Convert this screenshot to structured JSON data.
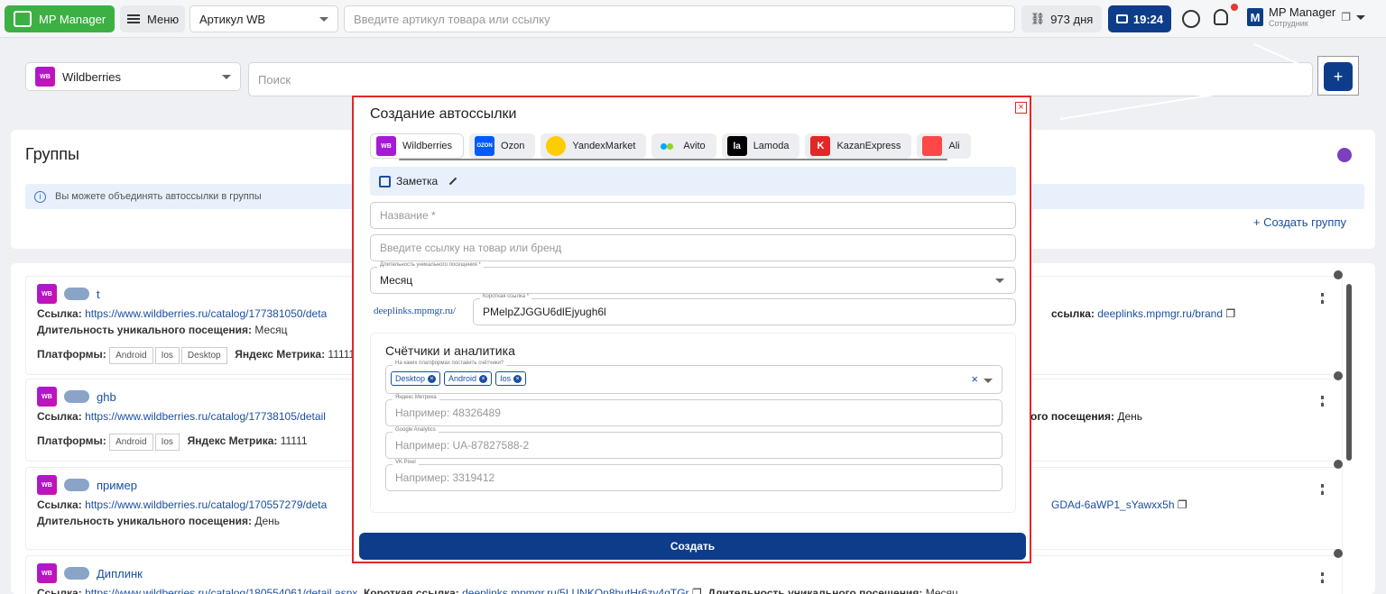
{
  "topbar": {
    "logo_label": "MP Manager",
    "menu_label": "Меню",
    "article_select": "Артикул WB",
    "search_placeholder": "Введите артикул товара или ссылку",
    "days": "973 дня",
    "time": "19:24",
    "user_name": "MP Manager",
    "user_role": "Сотрудник"
  },
  "filter": {
    "marketplace_badge": "WB",
    "marketplace": "Wildberries",
    "search_placeholder": "Поиск"
  },
  "groups": {
    "title": "Группы",
    "info": "Вы можете объединять автоссылки в группы",
    "create_label": "+  Создать группу"
  },
  "rows": [
    {
      "badge": "WB",
      "name": "t",
      "link_label": "Ссылка:",
      "link": "https://www.wildberries.ru/catalog/177381050/deta",
      "duration_label": "Длительность уникального посещения:",
      "duration": "Месяц",
      "platforms_label": "Платформы:",
      "platforms": [
        "Android",
        "Ios",
        "Desktop"
      ],
      "metrika_label": "Яндекс Метрика:",
      "metrika": "11111",
      "right_label": "ссылка:",
      "right_value": "deeplinks.mpmgr.ru/brand"
    },
    {
      "badge": "WB",
      "name": "ghb",
      "link_label": "Ссылка:",
      "link": "https://www.wildberries.ru/catalog/17738105/detail",
      "platforms_label": "Платформы:",
      "platforms": [
        "Android",
        "Ios"
      ],
      "metrika_label": "Яндекс Метрика:",
      "metrika": "11111",
      "right_label": "ого посещения:",
      "right_value": "День"
    },
    {
      "badge": "WB",
      "name": "пример",
      "link_label": "Ссылка:",
      "link": "https://www.wildberries.ru/catalog/170557279/deta",
      "duration_label": "Длительность уникального посещения:",
      "duration": "День",
      "right_value": "GDAd-6aWP1_sYawxx5h"
    },
    {
      "badge": "WB",
      "name": "Диплинк",
      "link_label": "Ссылка:",
      "link": "https://www.wildberries.ru/catalog/180554061/detail.aspx",
      "short_label": "Короткая ссылка:",
      "short": "deeplinks.mpmgr.ru/5LUNKOn8hutHr6zy4qTGr",
      "duration_label": "Длительность уникального посещения:",
      "duration": "Месяц"
    }
  ],
  "modal": {
    "title": "Создание автоссылки",
    "close": "×",
    "tabs": [
      {
        "label": "Wildberries",
        "icon": "WB",
        "color": "#a51ad6"
      },
      {
        "label": "Ozon",
        "icon": "OZON",
        "color": "#005bff"
      },
      {
        "label": "YandexMarket",
        "icon": "yandex-market-icon",
        "color": "#ffcc00"
      },
      {
        "label": "Avito",
        "icon": "avito-icon",
        "color": "#00aaff"
      },
      {
        "label": "Lamoda",
        "icon": "la",
        "color": "#000000"
      },
      {
        "label": "KazanExpress",
        "icon": "K",
        "color": "#e32626"
      },
      {
        "label": "Ali",
        "icon": "aliexpress-icon",
        "color": "#ff4747"
      }
    ],
    "note_label": "Заметка",
    "name_placeholder": "Название *",
    "link_placeholder": "Введите ссылку на товар или бренд",
    "duration_label": "Длительность уникального посещения *",
    "duration_value": "Месяц",
    "domain": "deeplinks.mpmgr.ru/",
    "short_label": "Короткая ссылка *",
    "short_value": "PMelpZJGGU6dlEjyugh6l",
    "counters_title": "Счётчики и аналитика",
    "platforms_label": "На каких платформах поставить счётчики?",
    "platforms": [
      "Desktop",
      "Android",
      "Ios"
    ],
    "clear": "×",
    "yandex_label": "Яндекс Метрика",
    "yandex_placeholder": "Например: 48326489",
    "google_label": "Google Analytics",
    "google_placeholder": "Например: UA-87827588-2",
    "vk_label": "VK Pixel",
    "vk_placeholder": "Например: 3319412",
    "submit": "Создать"
  },
  "plus_label": "+"
}
